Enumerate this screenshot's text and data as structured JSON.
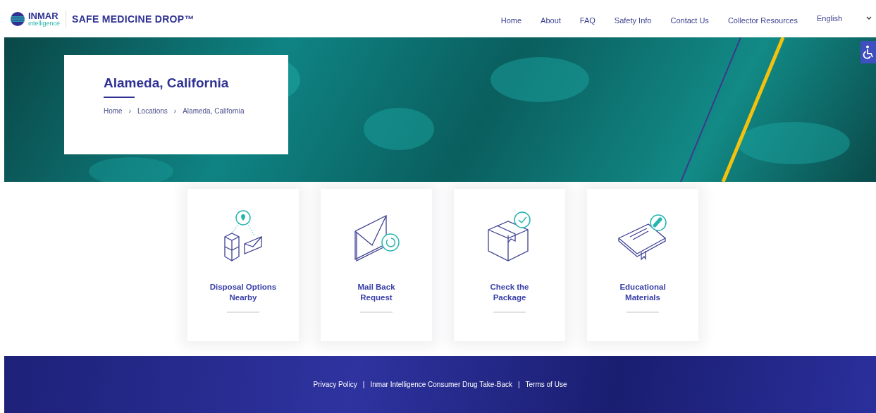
{
  "header": {
    "logo": {
      "brand": "INMAR",
      "sub": "intelligence"
    },
    "site_title": "SAFE MEDICINE DROP™",
    "nav": [
      "Home",
      "About",
      "FAQ",
      "Safety Info",
      "Contact Us",
      "Collector Resources"
    ],
    "language": "English"
  },
  "hero": {
    "title": "Alameda, California",
    "breadcrumb": [
      "Home",
      "Locations",
      "Alameda, California"
    ],
    "separator": "›"
  },
  "cards": [
    {
      "kind": "pin",
      "label": "Disposal Options Nearby"
    },
    {
      "kind": "envelope",
      "label": "Mail Back Request"
    },
    {
      "kind": "box",
      "label": "Check the Package"
    },
    {
      "kind": "book",
      "label": "Educational Materials"
    }
  ],
  "footer": {
    "links": [
      "Privacy Policy",
      "Inmar Intelligence Consumer Drug Take-Back",
      "Terms of Use"
    ],
    "separator": "|"
  }
}
